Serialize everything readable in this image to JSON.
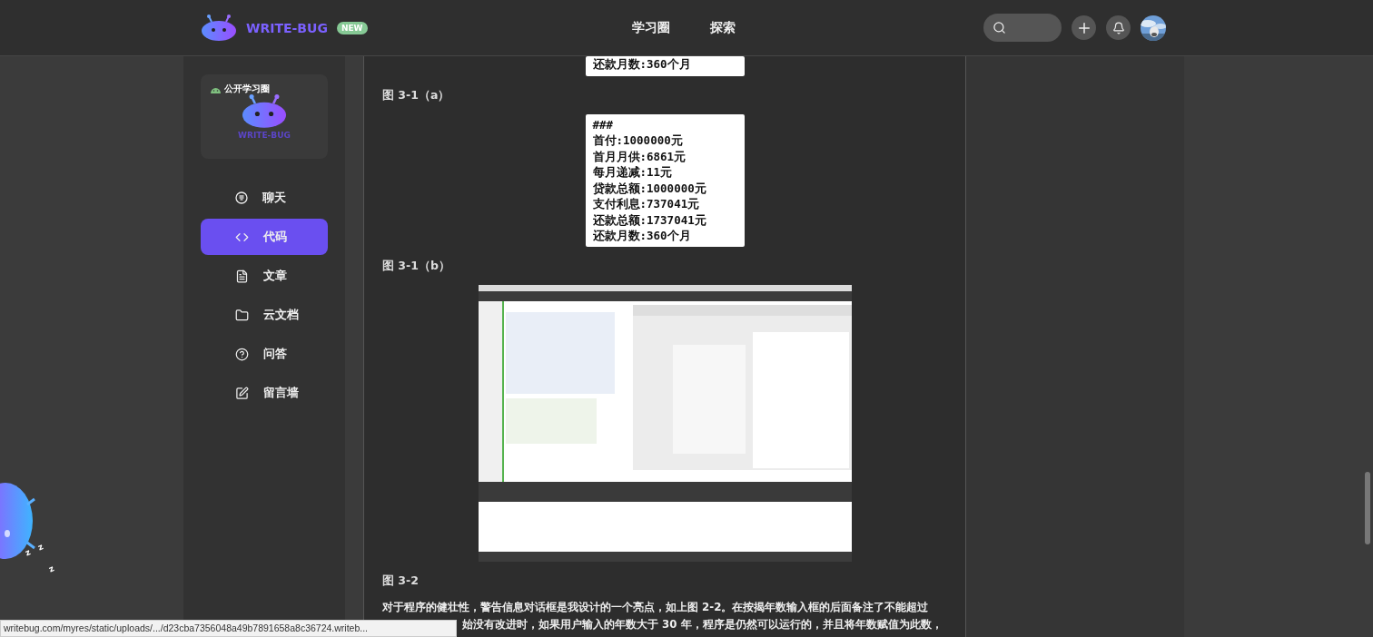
{
  "header": {
    "logo_text": "WRITE-BUG",
    "badge": "NEW",
    "nav": [
      {
        "label": "学习圈"
      },
      {
        "label": "探索"
      }
    ]
  },
  "sidebar": {
    "circle_card": {
      "tag": "公开学习圈",
      "name": "WRITE-BUG"
    },
    "items": [
      {
        "label": "聊天",
        "selected": false
      },
      {
        "label": "代码",
        "selected": true
      },
      {
        "label": "文章",
        "selected": false
      },
      {
        "label": "云文档",
        "selected": false
      },
      {
        "label": "问答",
        "selected": false
      },
      {
        "label": "留言墙",
        "selected": false
      }
    ]
  },
  "article": {
    "blocks": [
      {
        "kind": "result_box",
        "lines": [
          "还款月数:360个月"
        ]
      },
      {
        "kind": "caption",
        "text": "图 3-1（a）"
      },
      {
        "kind": "result_box",
        "lines": [
          "###",
          "首付:1000000元",
          "首月月供:6861元",
          "每月递减:11元",
          "贷款总额:1000000元",
          "支付利息:737041元",
          "还款总额:1737041元",
          "还款月数:360个月"
        ]
      },
      {
        "kind": "caption",
        "text": "图 3-1（b）"
      },
      {
        "kind": "picture"
      },
      {
        "kind": "caption",
        "text": "图 3-2"
      },
      {
        "kind": "paragraph",
        "lines": [
          {
            "text": "对于程序的健壮性，警告信息对话框是我设计的一个亮点，如上图 2-2。在按揭年数输入框的后面备注了不能超过",
            "clipped_start": false
          },
          {
            "text": "始没有改进时，如果用户输入的年数大于 30 年，程序是仍然可以运行的，并且将年数赋值为此数，",
            "clipped_start": true
          }
        ]
      }
    ]
  },
  "floating_mascot": {
    "sleep_marks": [
      "z",
      "z",
      "z"
    ]
  },
  "status_link": "writebug.com/myres/static/uploads/.../d23cba7356048a49b7891658a8c36724.writeb..."
}
